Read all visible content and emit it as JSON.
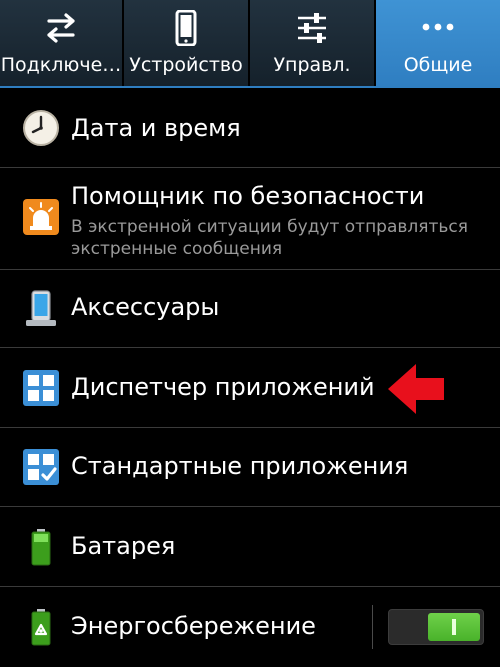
{
  "tabs": [
    {
      "label": "Подключе…",
      "icon": "connections-arrows-icon",
      "active": false
    },
    {
      "label": "Устройство",
      "icon": "phone-device-icon",
      "active": false
    },
    {
      "label": "Управл.",
      "icon": "sliders-control-icon",
      "active": false
    },
    {
      "label": "Общие",
      "icon": "more-dots-icon",
      "active": true
    }
  ],
  "settings": [
    {
      "title": "Дата и время",
      "icon": "clock-icon"
    },
    {
      "title": "Помощник по безопасности",
      "subtitle": "В экстренной ситуации будут отправляться экстренные сообщения",
      "icon": "emergency-siren-icon"
    },
    {
      "title": "Аксессуары",
      "icon": "phone-dock-icon"
    },
    {
      "title": "Диспетчер приложений",
      "icon": "app-grid-icon",
      "highlighted": true
    },
    {
      "title": "Стандартные приложения",
      "icon": "default-apps-check-icon"
    },
    {
      "title": "Батарея",
      "icon": "battery-icon"
    },
    {
      "title": "Энергосбережение",
      "icon": "power-saving-recycle-icon",
      "toggle_on": true
    }
  ],
  "colors": {
    "active_tab": "#2f7ec1",
    "toggle_on": "#49b22a",
    "highlight_arrow": "#e8101c"
  }
}
